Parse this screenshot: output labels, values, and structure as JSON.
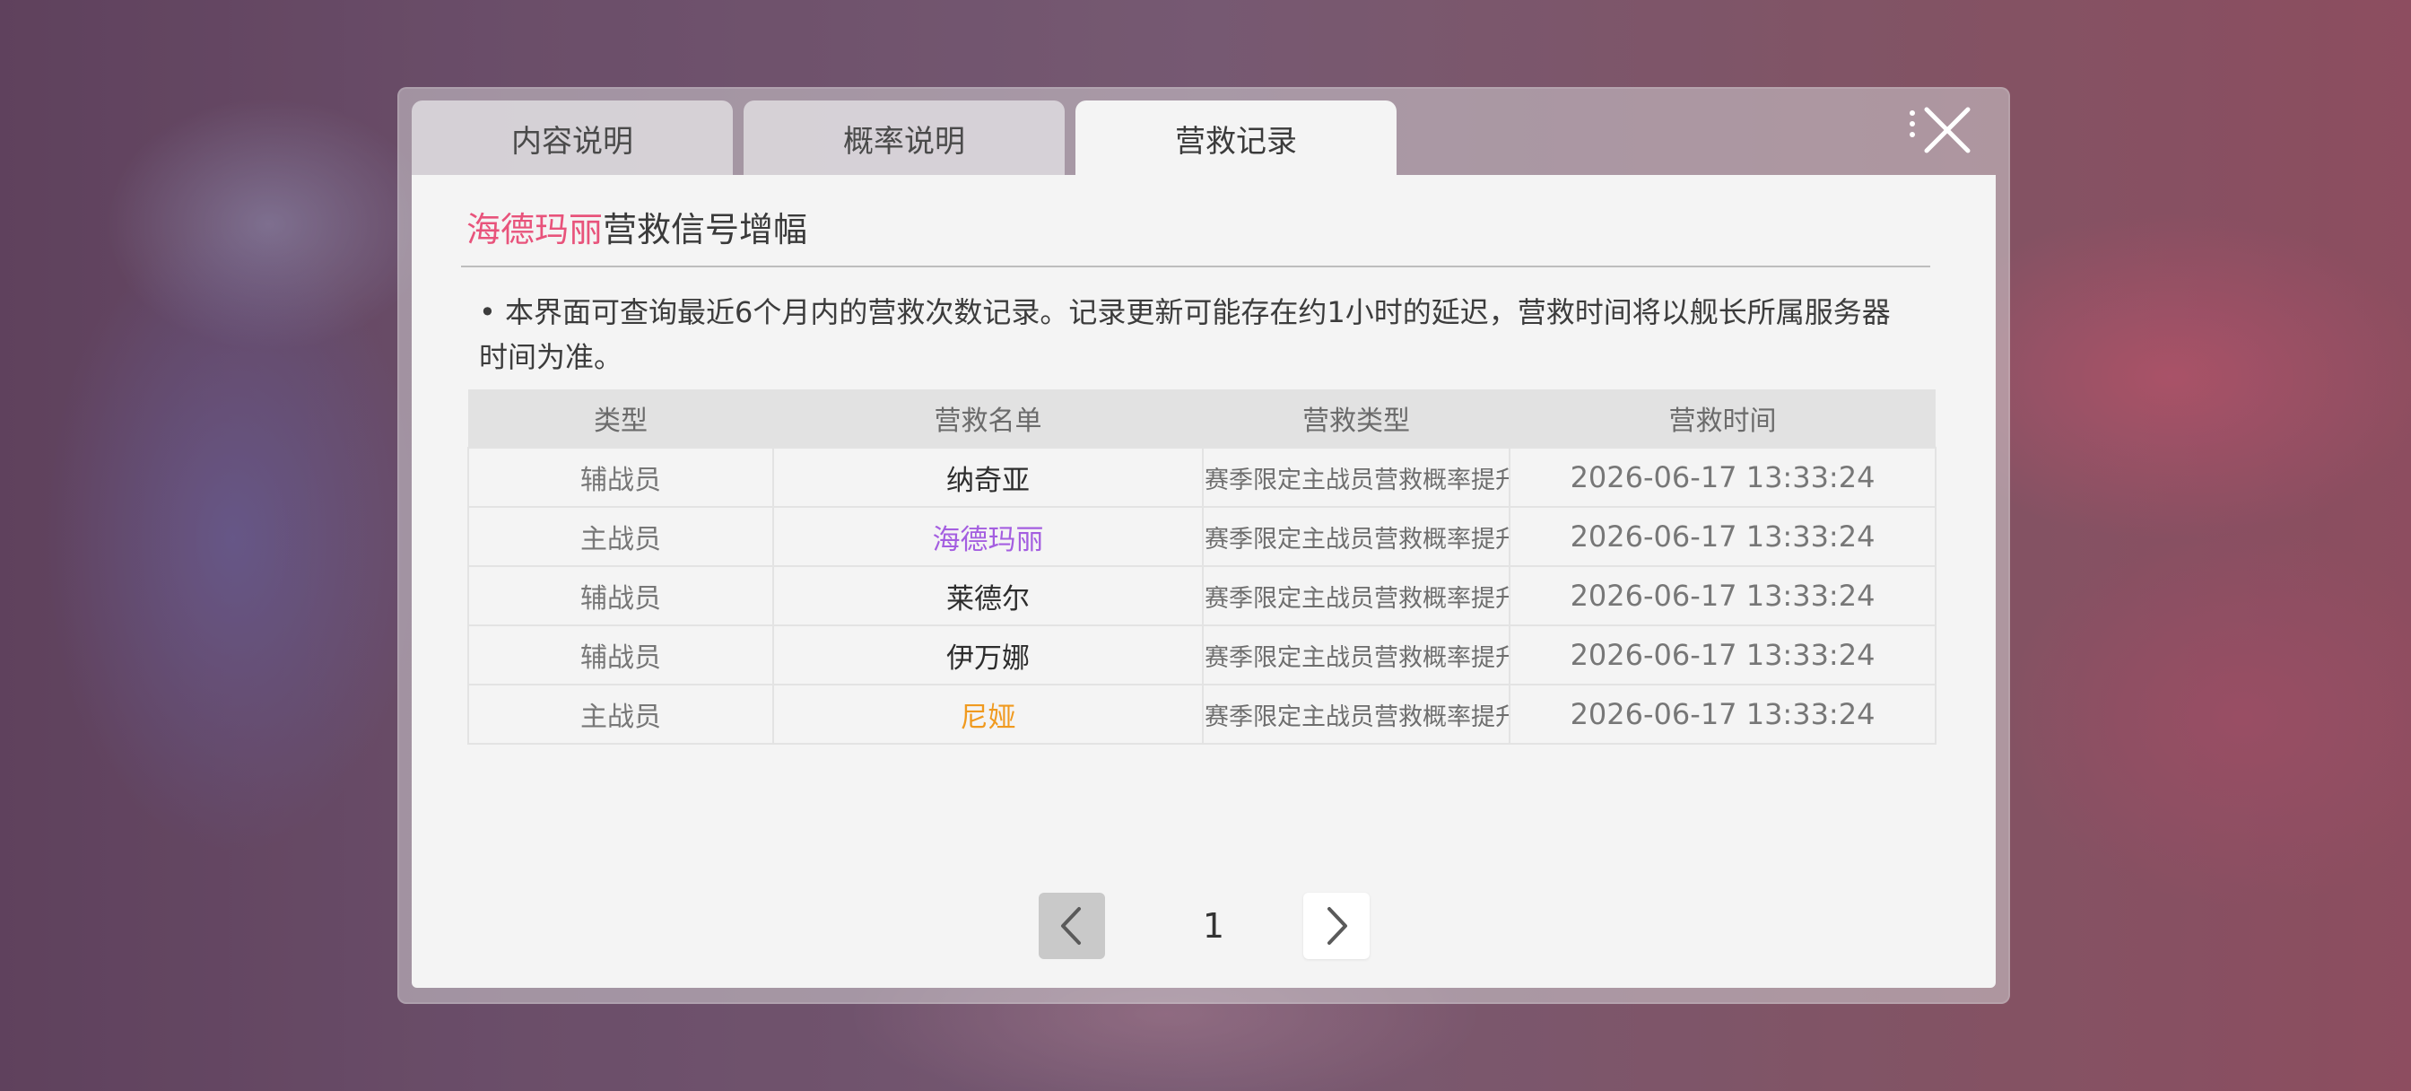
{
  "tabs": [
    {
      "label": "内容说明",
      "active": false
    },
    {
      "label": "概率说明",
      "active": false
    },
    {
      "label": "营救记录",
      "active": true
    }
  ],
  "panel": {
    "title_highlight": "海德玛丽",
    "title_rest": "营救信号增幅",
    "notice": "• 本界面可查询最近6个月内的营救次数记录。记录更新可能存在约1小时的延迟，营救时间将以舰长所属服务器时间为准。"
  },
  "table": {
    "headers": [
      "类型",
      "营救名单",
      "营救类型",
      "营救时间"
    ],
    "rows": [
      {
        "type": "辅战员",
        "name": "纳奇亚",
        "rescue_type": "赛季限定主战员营救概率提升",
        "time": "2026-06-17 13:33:24",
        "name_color": "#2d2d2d"
      },
      {
        "type": "主战员",
        "name": "海德玛丽",
        "rescue_type": "赛季限定主战员营救概率提升",
        "time": "2026-06-17 13:33:24",
        "name_color": "#a45ee0"
      },
      {
        "type": "辅战员",
        "name": "莱德尔",
        "rescue_type": "赛季限定主战员营救概率提升",
        "time": "2026-06-17 13:33:24",
        "name_color": "#2d2d2d"
      },
      {
        "type": "辅战员",
        "name": "伊万娜",
        "rescue_type": "赛季限定主战员营救概率提升",
        "time": "2026-06-17 13:33:24",
        "name_color": "#2d2d2d"
      },
      {
        "type": "主战员",
        "name": "尼娅",
        "rescue_type": "赛季限定主战员营救概率提升",
        "time": "2026-06-17 13:33:24",
        "name_color": "#f09a1f"
      }
    ]
  },
  "pagination": {
    "current_page": "1",
    "prev_icon": "chevron-left-icon",
    "next_icon": "chevron-right-icon"
  },
  "colors": {
    "highlight_pink": "#e8537b",
    "rarity_purple": "#a45ee0",
    "rarity_orange": "#f09a1f"
  }
}
